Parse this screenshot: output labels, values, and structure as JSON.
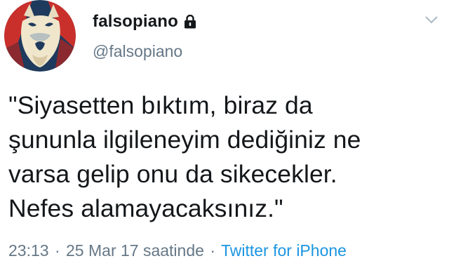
{
  "profile": {
    "display_name": "falsopiano",
    "handle": "@falsopiano",
    "protected": true
  },
  "tweet": {
    "lines": [
      "\"Siyasetten bıktım, biraz da",
      "şununla ilgileneyim dediğiniz ne",
      "varsa gelip onu da sikecekler.",
      "Nefes alamayacaksınız.\""
    ],
    "time": "23:13",
    "separator": "·",
    "date": "25 Mar 17 saatinde",
    "source": "Twitter for iPhone"
  },
  "colors": {
    "text": "#14171a",
    "secondary": "#657786",
    "link": "#1b95e0"
  },
  "icons": {
    "lock": "lock-icon",
    "menu": "chevron-down-icon",
    "avatar": "avatar"
  }
}
